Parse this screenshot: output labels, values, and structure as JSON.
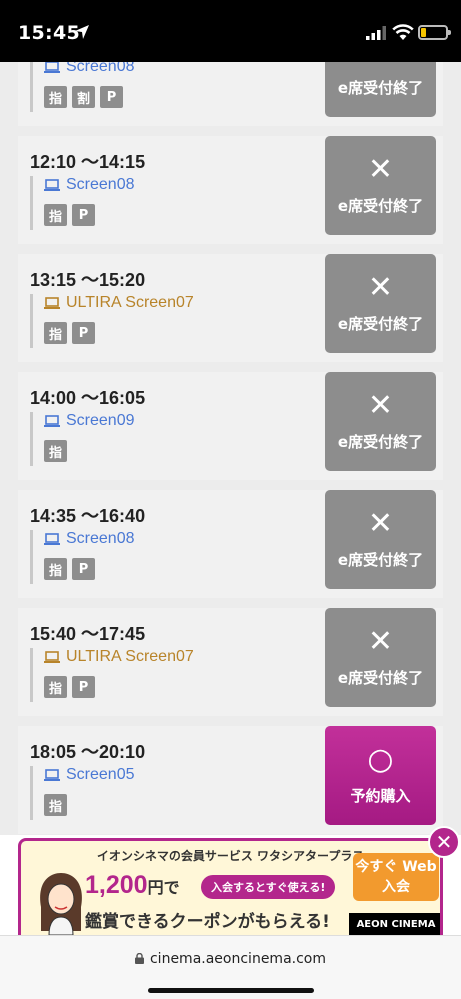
{
  "status_bar": {
    "time": "15:45"
  },
  "showtimes": [
    {
      "time": "",
      "screen": "Screen08",
      "screen_color": "blue",
      "badges": [
        "指",
        "割",
        "P"
      ],
      "status_mark": "✕",
      "status_label": "e席受付終了",
      "available": false
    },
    {
      "time": "12:10 〜14:15",
      "screen": "Screen08",
      "screen_color": "blue",
      "badges": [
        "指",
        "P"
      ],
      "status_mark": "✕",
      "status_label": "e席受付終了",
      "available": false
    },
    {
      "time": "13:15 〜15:20",
      "screen": "ULTIRA Screen07",
      "screen_color": "gold",
      "badges": [
        "指",
        "P"
      ],
      "status_mark": "✕",
      "status_label": "e席受付終了",
      "available": false
    },
    {
      "time": "14:00 〜16:05",
      "screen": "Screen09",
      "screen_color": "blue",
      "badges": [
        "指"
      ],
      "status_mark": "✕",
      "status_label": "e席受付終了",
      "available": false
    },
    {
      "time": "14:35 〜16:40",
      "screen": "Screen08",
      "screen_color": "blue",
      "badges": [
        "指",
        "P"
      ],
      "status_mark": "✕",
      "status_label": "e席受付終了",
      "available": false
    },
    {
      "time": "15:40 〜17:45",
      "screen": "ULTIRA Screen07",
      "screen_color": "gold",
      "badges": [
        "指",
        "P"
      ],
      "status_mark": "✕",
      "status_label": "e席受付終了",
      "available": false
    },
    {
      "time": "18:05 〜20:10",
      "screen": "Screen05",
      "screen_color": "blue",
      "badges": [
        "指"
      ],
      "status_mark": "○",
      "status_label": "予約購入",
      "available": true
    }
  ],
  "ad": {
    "headline": "イオンシネマの会員サービス ワタシアタープラス",
    "price": "1,200",
    "price_suffix": "円で",
    "pill": "入会するとすぐ使える!",
    "subline": "鑑賞できるクーポンがもらえる!",
    "cta": "今すぐ Web入会",
    "logo": "AEON CINEMA"
  },
  "url_bar": {
    "url": "cinema.aeoncinema.com"
  },
  "colors": {
    "accent": "#b3268c",
    "closed_gray": "#8d8d8d",
    "link_blue": "#4a78d4",
    "ultira_gold": "#b8842a"
  }
}
